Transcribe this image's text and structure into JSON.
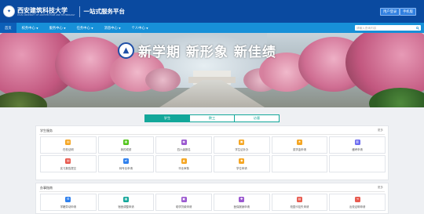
{
  "header": {
    "logo_cn": "西安建筑科技大学",
    "logo_en": "XI'AN UNIVERSITY OF ARCHITECTURE AND TECHNOLOGY",
    "platform_title": "一站式服务平台",
    "btn_login": "用户登录",
    "btn_mobile": "手机版"
  },
  "nav": {
    "items": [
      {
        "label": "首页",
        "active": true
      },
      {
        "label": "校务中心"
      },
      {
        "label": "服务中心"
      },
      {
        "label": "任务中心"
      },
      {
        "label": "消息中心"
      },
      {
        "label": "个人中心"
      }
    ],
    "search_placeholder": "请输入查询内容",
    "search_icon": "search-icon"
  },
  "banner": {
    "slogan": "新学期  新形象  新佳绩"
  },
  "tabs": [
    {
      "label": "学生",
      "active": true
    },
    {
      "label": "教工"
    },
    {
      "label": "访客"
    }
  ],
  "sections": [
    {
      "title": "学生服务",
      "more": "更多",
      "items": [
        {
          "label": "在校证明",
          "icon": "id-card-icon",
          "color": "#f5a623"
        },
        {
          "label": "我的成绩",
          "icon": "score-icon",
          "color": "#52c41a"
        },
        {
          "label": "四六级报名",
          "icon": "exam-icon",
          "color": "#9b59d0"
        },
        {
          "label": "学生证补办",
          "icon": "card-icon",
          "color": "#f5a623"
        },
        {
          "label": "奖学金申请",
          "icon": "award-icon",
          "color": "#f5a623"
        },
        {
          "label": "缓考申请",
          "icon": "calendar-icon",
          "color": "#6c6cf0"
        },
        {
          "label": "实习报告提交",
          "icon": "report-icon",
          "color": "#e85a4f"
        },
        {
          "label": "转专业申请",
          "icon": "transfer-icon",
          "color": "#2f80ed"
        },
        {
          "label": "毕业审核",
          "icon": "graduate-icon",
          "color": "#f5a623"
        },
        {
          "label": "学位申请",
          "icon": "degree-icon",
          "color": "#f5a623"
        }
      ]
    },
    {
      "title": "办事指南",
      "more": "更多",
      "items": [
        {
          "label": "学籍异动申请",
          "icon": "gear-icon",
          "color": "#2f80ed"
        },
        {
          "label": "宿舍调整申请",
          "icon": "dorm-icon",
          "color": "#13a79a"
        },
        {
          "label": "助学贷款申请",
          "icon": "loan-icon",
          "color": "#9b59d0"
        },
        {
          "label": "医保报销申请",
          "icon": "medical-icon",
          "color": "#9b59d0"
        },
        {
          "label": "校园卡挂失申请",
          "icon": "campus-card-icon",
          "color": "#e85a4f"
        },
        {
          "label": "出校证明申请",
          "icon": "exit-icon",
          "color": "#e85a4f"
        }
      ]
    }
  ]
}
